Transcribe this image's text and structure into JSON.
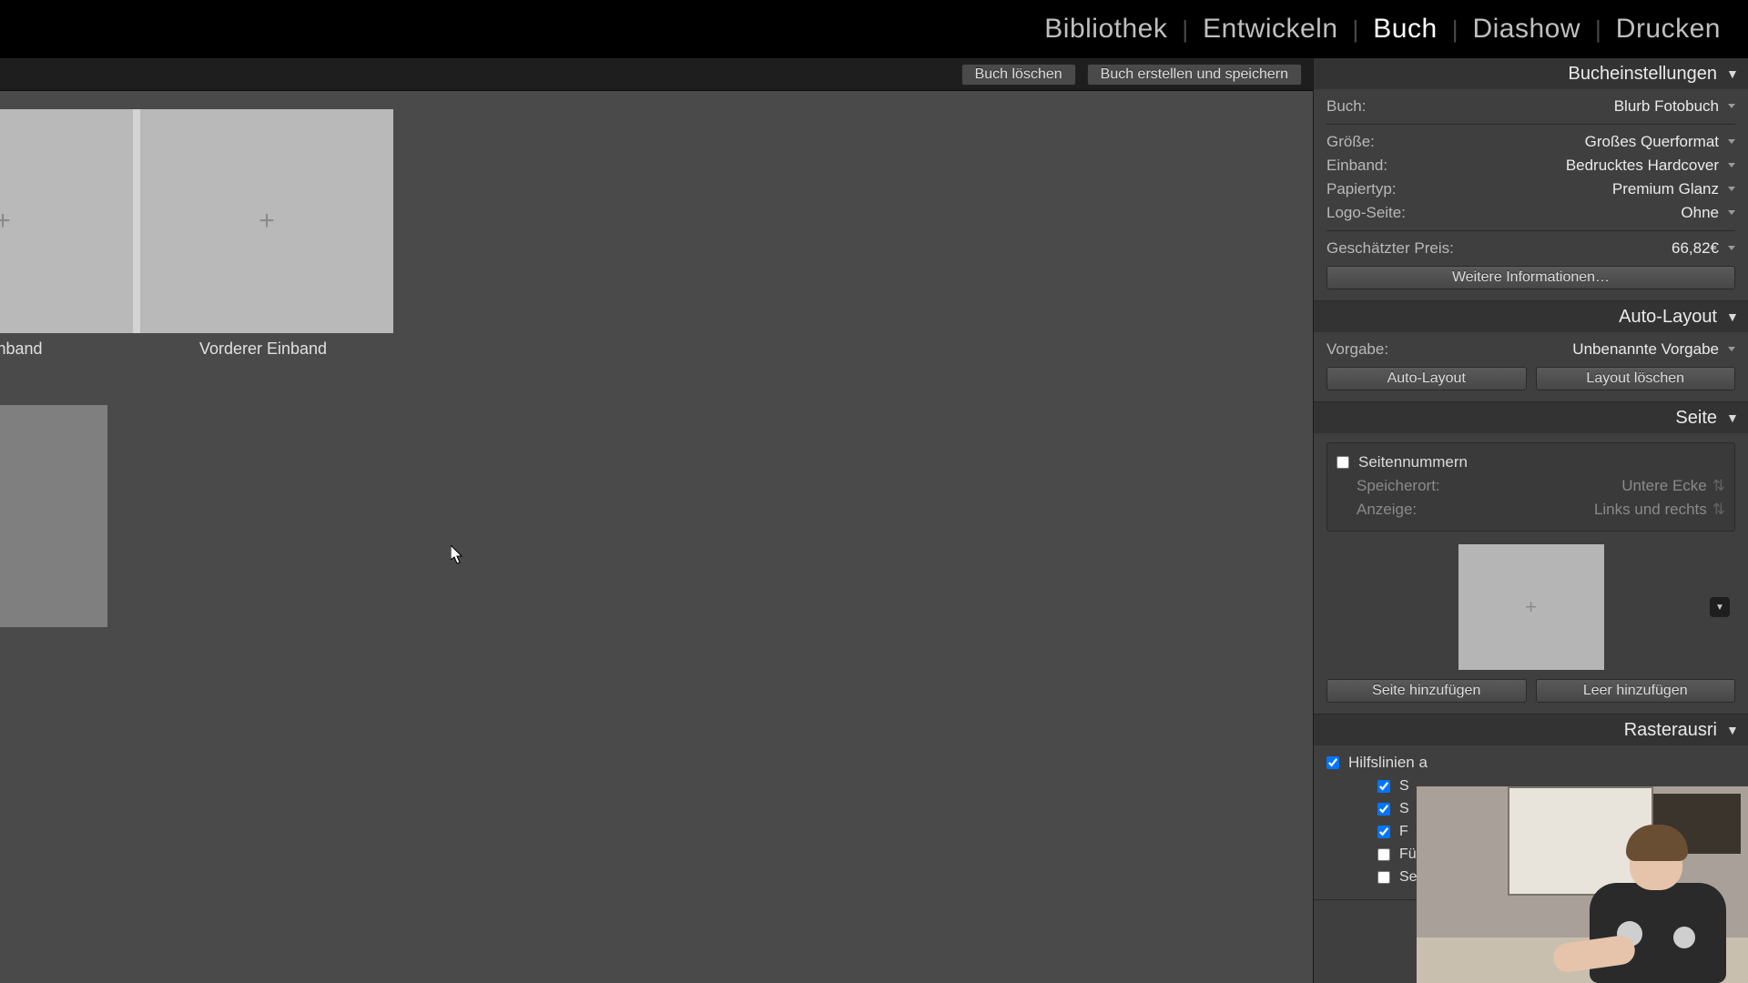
{
  "top_nav": {
    "modules": [
      "Bibliothek",
      "Entwickeln",
      "Buch",
      "Diashow",
      "Drucken"
    ],
    "active": "Buch"
  },
  "action_bar": {
    "clear": "Buch löschen",
    "create": "Buch erstellen und speichern"
  },
  "canvas": {
    "back_cover_label": "er Einband",
    "front_cover_label": "Vorderer Einband"
  },
  "book_settings": {
    "title": "Bucheinstellungen",
    "book_label": "Buch:",
    "book_value": "Blurb Fotobuch",
    "size_label": "Größe:",
    "size_value": "Großes Querformat",
    "cover_label": "Einband:",
    "cover_value": "Bedrucktes Hardcover",
    "paper_label": "Papiertyp:",
    "paper_value": "Premium Glanz",
    "logo_label": "Logo-Seite:",
    "logo_value": "Ohne",
    "price_label": "Geschätzter Preis:",
    "price_value": "66,82€",
    "more_info": "Weitere Informationen…"
  },
  "auto_layout": {
    "title": "Auto-Layout",
    "preset_label": "Vorgabe:",
    "preset_value": "Unbenannte Vorgabe",
    "auto_btn": "Auto-Layout",
    "clear_btn": "Layout löschen"
  },
  "page": {
    "title": "Seite",
    "page_numbers_label": "Seitennummern",
    "location_label": "Speicherort:",
    "location_value": "Untere Ecke",
    "display_label": "Anzeige:",
    "display_value": "Links und rechts",
    "add_page_btn": "Seite hinzufügen",
    "add_blank_btn": "Leer hinzufügen"
  },
  "guides": {
    "title": "Rasterausri",
    "enable_label": "Hilfslinien a",
    "sub1": "S",
    "sub2": "S",
    "sub3": "F",
    "sub4": "Fülltext",
    "sub5": "Seitenraster"
  }
}
